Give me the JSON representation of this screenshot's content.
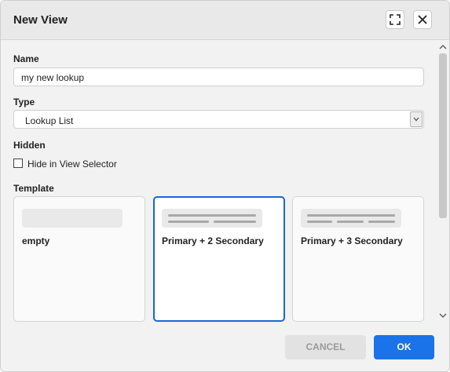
{
  "dialog": {
    "title": "New View",
    "maximize_icon": "expand-icon",
    "close_icon": "close-icon"
  },
  "name": {
    "label": "Name",
    "value": "my new lookup"
  },
  "type": {
    "label": "Type",
    "selected": "Lookup List"
  },
  "hidden": {
    "label": "Hidden",
    "checkbox_label": "Hide in View Selector",
    "checked": false
  },
  "template": {
    "label": "Template",
    "options": [
      {
        "label": "empty",
        "selected": false
      },
      {
        "label": "Primary + 2 Secondary",
        "selected": true
      },
      {
        "label": "Primary + 3 Secondary",
        "selected": false
      }
    ]
  },
  "footer": {
    "cancel_label": "CANCEL",
    "ok_label": "OK"
  },
  "colors": {
    "accent": "#1a73e8",
    "selected_border": "#1a66d6"
  }
}
